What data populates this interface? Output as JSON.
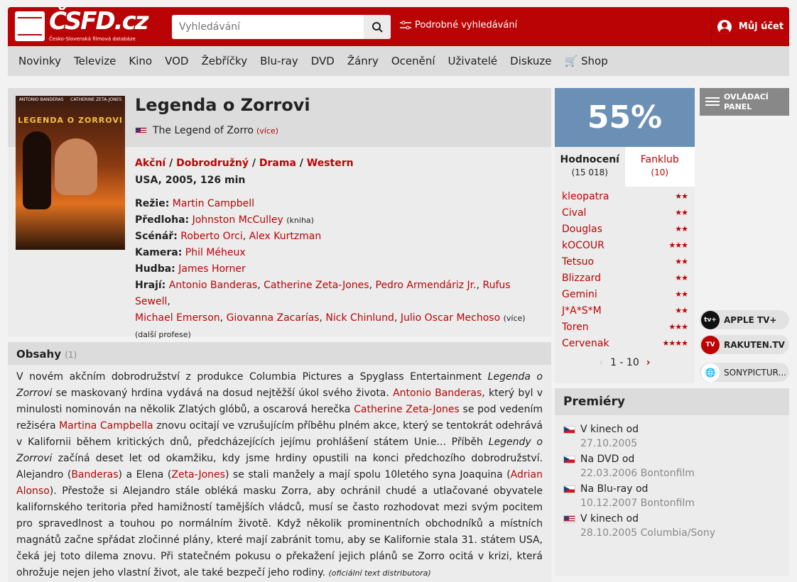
{
  "header": {
    "logo_text": "ČSFD.cz",
    "logo_sub": "Česko-Slovenská filmová databáze",
    "search_placeholder": "Vyhledávání",
    "advanced_search": "Podrobné vyhledávání",
    "account": "Můj účet"
  },
  "nav": [
    "Novinky",
    "Televize",
    "Kino",
    "VOD",
    "Žebříčky",
    "Blu-ray",
    "DVD",
    "Žánry",
    "Ocenění",
    "Uživatelé",
    "Diskuze",
    "Shop"
  ],
  "film": {
    "poster_left": "ANTONIO BANDERAS",
    "poster_right": "CATHERINE ZETA-JONES",
    "poster_title": "LEGENDA O ZORROVI",
    "title": "Legenda o Zorrovi",
    "original_title": "The Legend of Zorro",
    "more": "(více)",
    "genres": [
      "Akční",
      "Dobrodružný",
      "Drama",
      "Western"
    ],
    "origin": "USA, 2005, 126 min",
    "directing_label": "Režie:",
    "director": "Martin Campbell",
    "source_label": "Předloha:",
    "source": "Johnston McCulley",
    "source_note": "(kniha)",
    "writers_label": "Scénář:",
    "writers": [
      "Roberto Orci",
      "Alex Kurtzman"
    ],
    "camera_label": "Kamera:",
    "camera": "Phil Méheux",
    "music_label": "Hudba:",
    "music": "James Horner",
    "cast_label": "Hrají:",
    "cast": [
      "Antonio Banderas",
      "Catherine Zeta-Jones",
      "Pedro Armendáriz Jr.",
      "Rufus Sewell",
      "Michael Emerson",
      "Giovanna Zacarías",
      "Nick Chinlund",
      "Julio Oscar Mechoso"
    ],
    "cast_more": "(více)",
    "more_roles": "(další profese)"
  },
  "synopsis": {
    "heading": "Obsahy",
    "count": "(1)",
    "source_note": "(oficiální text distributora)"
  },
  "rating": {
    "percent": "55%",
    "tab_ratings": "Hodnocení",
    "tab_ratings_count": "(15 018)",
    "tab_fanclub": "Fanklub",
    "tab_fanclub_count": "(10)",
    "users": [
      {
        "name": "kleopatra",
        "stars": 2
      },
      {
        "name": "Cival",
        "stars": 2
      },
      {
        "name": "Douglas",
        "stars": 2
      },
      {
        "name": "kOCOUR",
        "stars": 3
      },
      {
        "name": "Tetsuo",
        "stars": 2
      },
      {
        "name": "Blizzard",
        "stars": 2
      },
      {
        "name": "Gemini",
        "stars": 2
      },
      {
        "name": "J*A*S*M",
        "stars": 2
      },
      {
        "name": "Toren",
        "stars": 3
      },
      {
        "name": "Cervenak",
        "stars": 4
      }
    ],
    "pager": "1 - 10"
  },
  "control_panel": "OVLÁDACÍ PANEL",
  "vod": [
    {
      "name": "APPLE TV+",
      "badge": "tv+"
    },
    {
      "name": "RAKUTEN.TV",
      "badge": "TV"
    },
    {
      "name": "SONYPICTUR...",
      "badge": "🌐"
    }
  ],
  "premieres": {
    "heading": "Premiéry",
    "items": [
      {
        "flag": "cz",
        "label": "V kinech od",
        "date": "27.10.2005"
      },
      {
        "flag": "cz",
        "label": "Na DVD od",
        "date": "22.03.2006 Bontonfilm"
      },
      {
        "flag": "cz",
        "label": "Na Blu-ray od",
        "date": "10.12.2007 Bontonfilm"
      },
      {
        "flag": "us",
        "label": "V kinech od",
        "date": "28.10.2005 Columbia/Sony"
      }
    ]
  }
}
